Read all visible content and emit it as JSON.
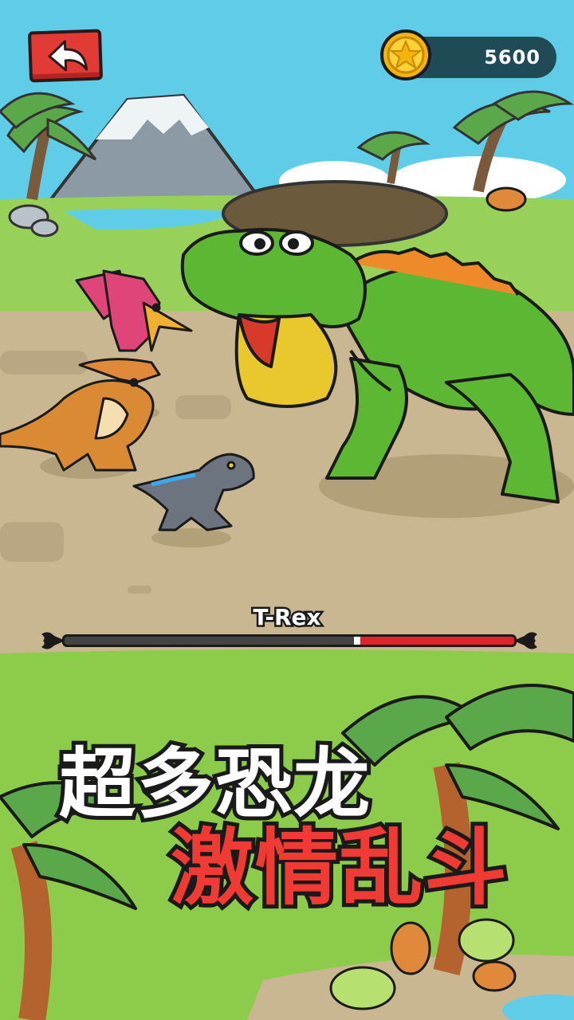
{
  "game": {
    "coins": "5600",
    "boss_name": "T-Rex",
    "boss_hp_fraction": 0.35,
    "promo_line_1": "超多恐龙",
    "promo_line_2": "激情乱斗"
  },
  "icons": {
    "back": "back-arrow-icon",
    "coin": "star-coin-icon"
  },
  "colors": {
    "sky": "#5fcde8",
    "grass": "#8ccc4a",
    "dirt": "#c9b792",
    "hp_red": "#e0242c",
    "back_button": "#e23a35",
    "promo_red": "#ef3b34"
  }
}
